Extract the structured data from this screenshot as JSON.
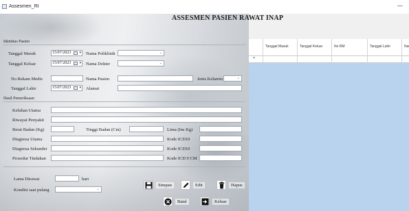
{
  "window": {
    "title": "Assesmen_RI",
    "minimize_glyph": "—"
  },
  "form": {
    "heading": "ASSESMEN PASIEN RAWAT INAP",
    "section_identitas": "Identitas Pasien",
    "tanggal_masuk": {
      "label": "Tanggal Masuk",
      "value": "15/07/2023"
    },
    "tanggal_keluar": {
      "label": "Tanggal Keluar",
      "value": "15/07/2023"
    },
    "nama_poliklinik": {
      "label": "Nama Poliklinik",
      "value": ""
    },
    "nama_dokter": {
      "label": "Nama Dokter",
      "value": ""
    },
    "no_rekam_medis": {
      "label": "No Rekam Medis",
      "value": ""
    },
    "nama_pasien": {
      "label": "Nama Pasien",
      "value": ""
    },
    "jenis_kelamin": {
      "label": "Jenis Kelamin",
      "value": ""
    },
    "tanggal_lahir": {
      "label": "Tanggal Lahir",
      "value": "15/07/2023"
    },
    "alamat": {
      "label": "Alamat",
      "value": ""
    },
    "section_hasil": "Hasil Pemeriksaan",
    "keluhan_utama": {
      "label": "Keluhan Utama",
      "value": ""
    },
    "riwayat_penyakit": {
      "label": "Riwayat Penyakit",
      "value": ""
    },
    "berat_badan": {
      "label": "Berat Badan (Kg)",
      "value": ""
    },
    "tinggi_badan": {
      "label": "Tinggi Badan (Cm)",
      "value": ""
    },
    "lima": {
      "label": "Lima (Ins Kg)",
      "value": ""
    },
    "diagnosa_utama": {
      "label": "Diagnosa Utama",
      "value": ""
    },
    "kode_icd10_a": {
      "label": "Kode ICD10",
      "value": ""
    },
    "diagnosa_sekunder": {
      "label": "Diagnosa Sekunder",
      "value": ""
    },
    "kode_icd10_b": {
      "label": "Kode ICD10",
      "value": ""
    },
    "prosedur_tindakan": {
      "label": "Prosedur Tindakan",
      "value": ""
    },
    "kode_icd9": {
      "label": "Kode ICD 9 CM",
      "value": ""
    },
    "lama_dirawat": {
      "label": "Lama Dirawat",
      "value": "",
      "unit": "hari"
    },
    "kondisi_pulang": {
      "label": "Kondisi saat pulang",
      "value": ""
    }
  },
  "buttons": {
    "simpan": "Simpan",
    "edit": "Edit",
    "hapus": "Hapus",
    "batal": "Batal",
    "keluar": "Keluar"
  },
  "grid": {
    "columns": [
      "Tanggal Masuk",
      "Tanggal Keluar",
      "No RM",
      "Tanggal Lahir",
      "Nam"
    ],
    "new_row_marker": "*"
  },
  "colors": {
    "grid_background": "#b9d3ee",
    "window_background": "#f0f0f0"
  }
}
